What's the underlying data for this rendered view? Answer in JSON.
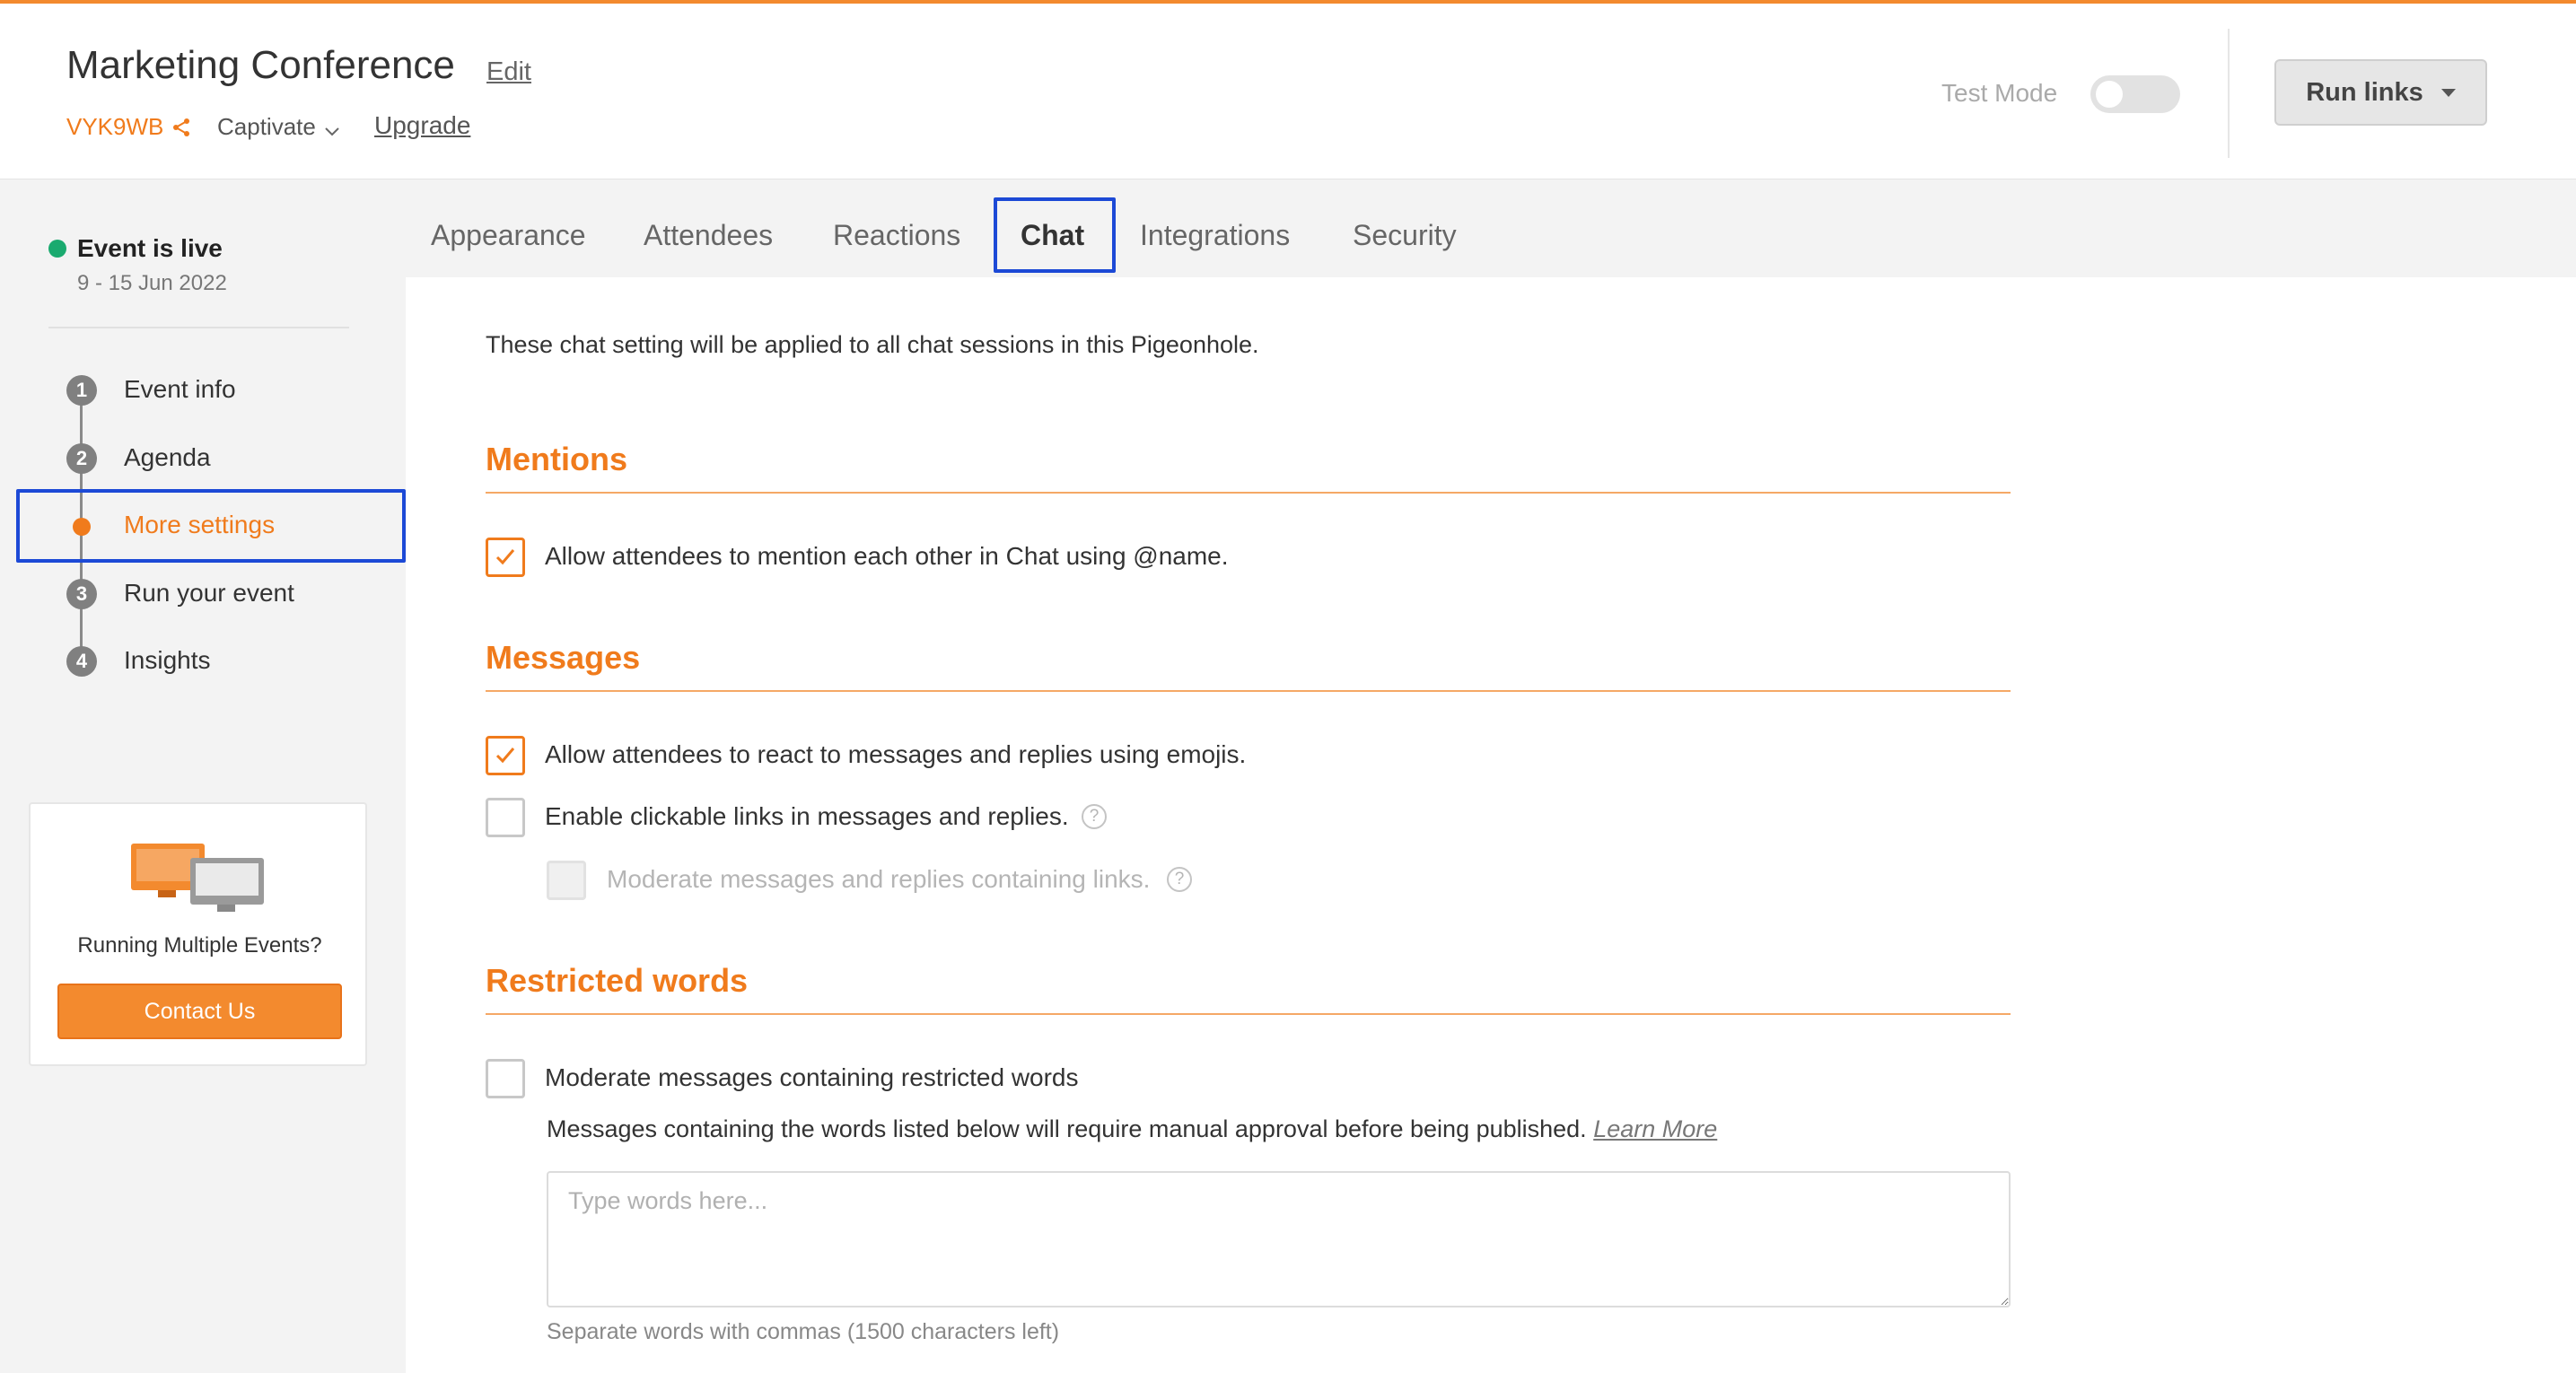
{
  "header": {
    "title": "Marketing Conference",
    "edit_label": "Edit",
    "event_code": "VYK9WB",
    "plan": "Captivate",
    "upgrade_label": "Upgrade",
    "test_mode_label": "Test Mode",
    "test_mode_on": false,
    "run_links_label": "Run links",
    "accent_color": "#f07b1c"
  },
  "sidebar": {
    "status": "Event is live",
    "dates": "9 - 15 Jun 2022",
    "steps": [
      {
        "number": "1",
        "label": "Event info"
      },
      {
        "number": "2",
        "label": "Agenda"
      },
      {
        "number": "",
        "label": "More settings",
        "active": true
      },
      {
        "number": "3",
        "label": "Run your event"
      },
      {
        "number": "4",
        "label": "Insights"
      }
    ],
    "promo": {
      "text": "Running Multiple Events?",
      "button_label": "Contact Us"
    }
  },
  "tabs": [
    {
      "label": "Appearance"
    },
    {
      "label": "Attendees"
    },
    {
      "label": "Reactions"
    },
    {
      "label": "Chat",
      "active": true
    },
    {
      "label": "Integrations"
    },
    {
      "label": "Security"
    }
  ],
  "main": {
    "intro": "These chat setting will be applied to all chat sessions in this Pigeonhole.",
    "mentions": {
      "title": "Mentions",
      "allow_mentions_label": "Allow attendees to mention each other in Chat using @name.",
      "allow_mentions_checked": true
    },
    "messages": {
      "title": "Messages",
      "allow_reactions_label": "Allow attendees to react to messages and replies using emojis.",
      "allow_reactions_checked": true,
      "clickable_links_label": "Enable clickable links in messages and replies.",
      "clickable_links_checked": false,
      "moderate_links_label": "Moderate messages and replies containing links.",
      "moderate_links_checked": false,
      "moderate_links_disabled": true
    },
    "restricted": {
      "title": "Restricted words",
      "moderate_label": "Moderate messages containing restricted words",
      "moderate_checked": false,
      "note": "Messages containing the words listed below will require manual approval before being published.",
      "learn_more_label": "Learn More",
      "input_placeholder": "Type words here...",
      "input_value": "",
      "hint": "Separate words with commas (1500 characters left)"
    }
  }
}
